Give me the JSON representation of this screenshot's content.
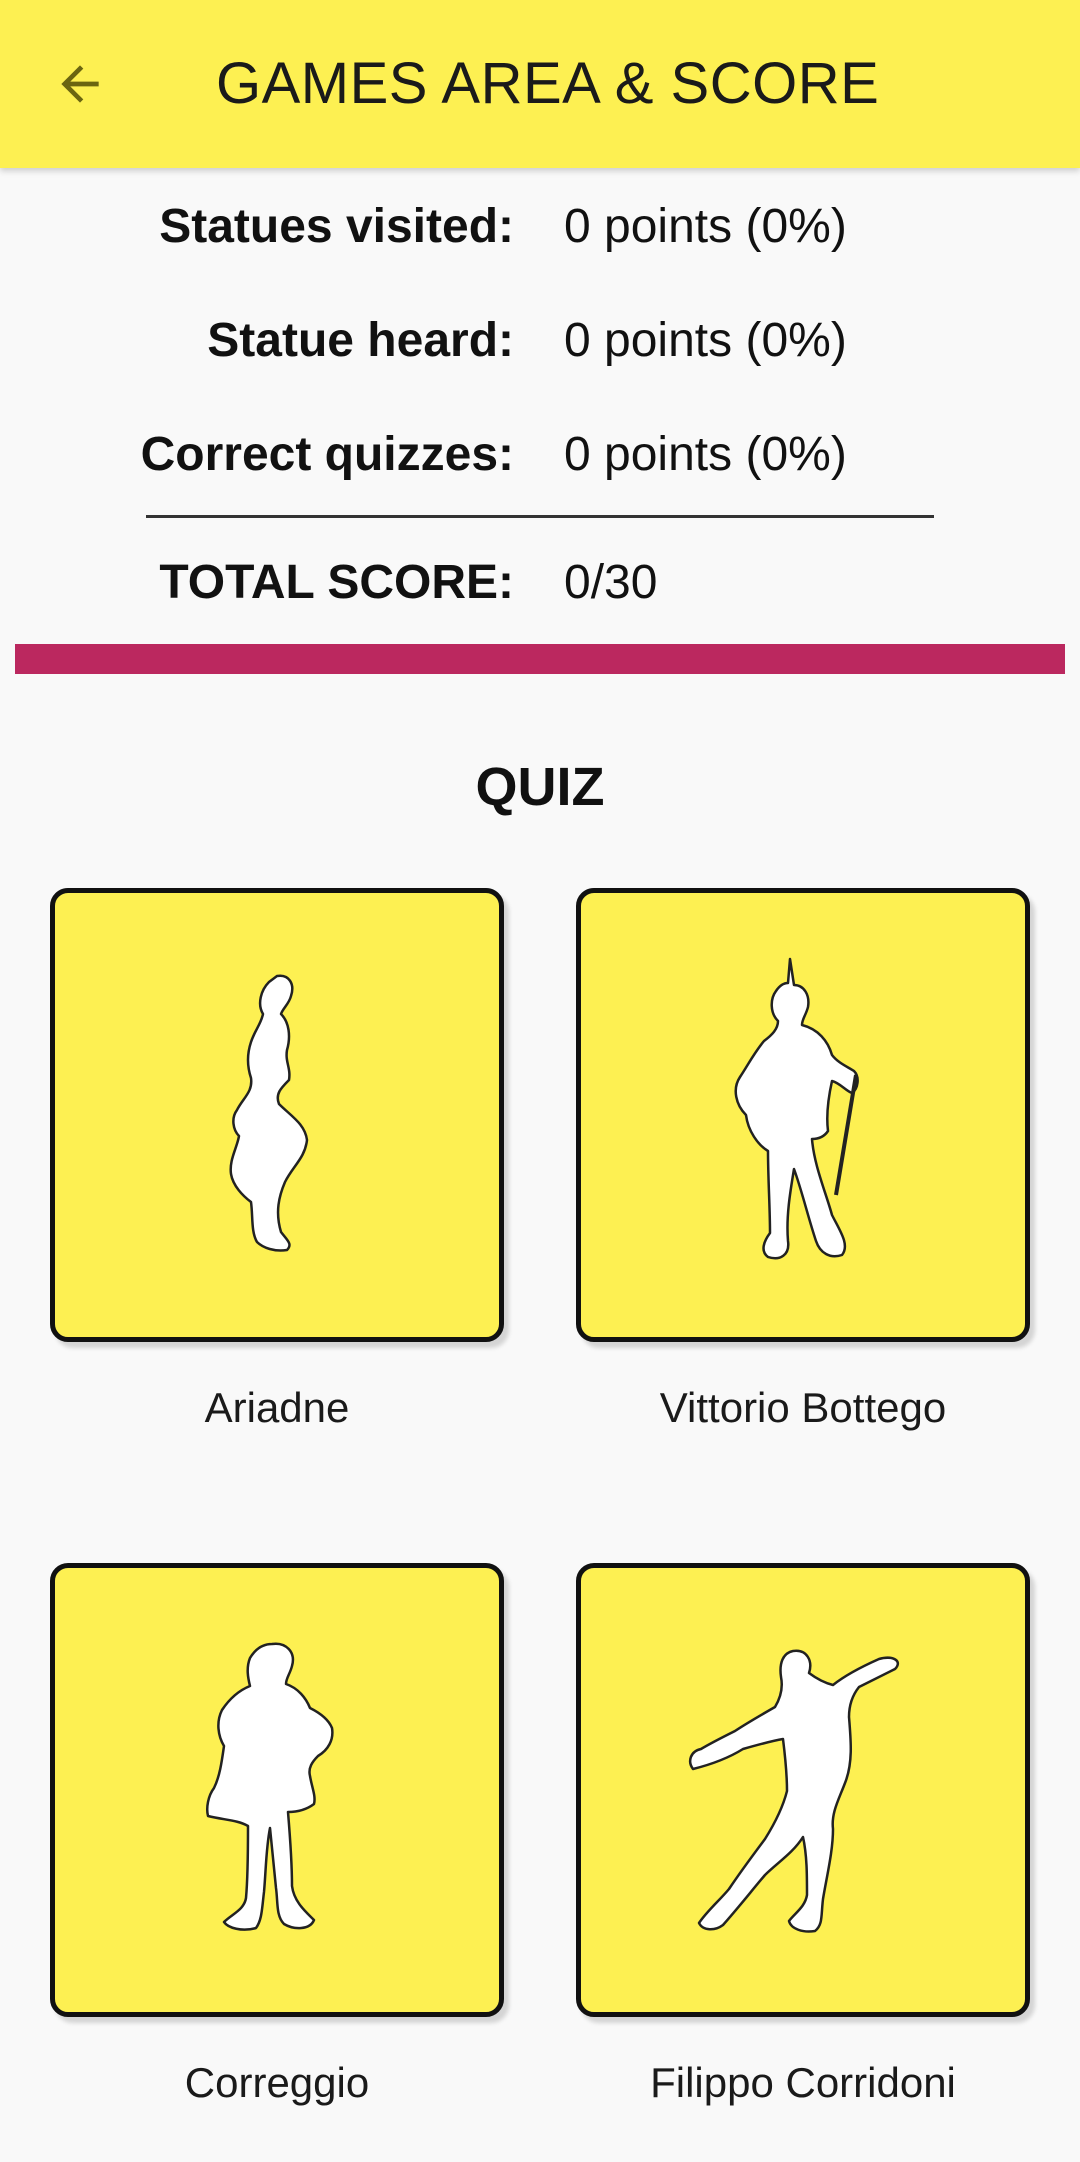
{
  "header": {
    "back_icon": "arrow-left-icon",
    "title": "GAMES AREA & SCORE"
  },
  "score": {
    "rows": [
      {
        "label": "Statues visited:",
        "value": "0 points (0%)"
      },
      {
        "label": "Statue heard:",
        "value": "0 points (0%)"
      },
      {
        "label": "Correct quizzes:",
        "value": "0 points (0%)"
      }
    ],
    "total_label": "TOTAL SCORE:",
    "total_value": "0/30"
  },
  "quiz": {
    "heading": "QUIZ",
    "items": [
      {
        "name": "Ariadne",
        "icon": "statue-silhouette-icon"
      },
      {
        "name": "Vittorio Bottego",
        "icon": "statue-silhouette-icon"
      },
      {
        "name": "Correggio",
        "icon": "statue-silhouette-icon"
      },
      {
        "name": "Filippo Corridoni",
        "icon": "statue-silhouette-icon"
      }
    ]
  },
  "colors": {
    "header_bg": "#fdf052",
    "card_bg": "#fdf052",
    "accent": "#bb285f",
    "page_bg": "#f9f9f9"
  }
}
